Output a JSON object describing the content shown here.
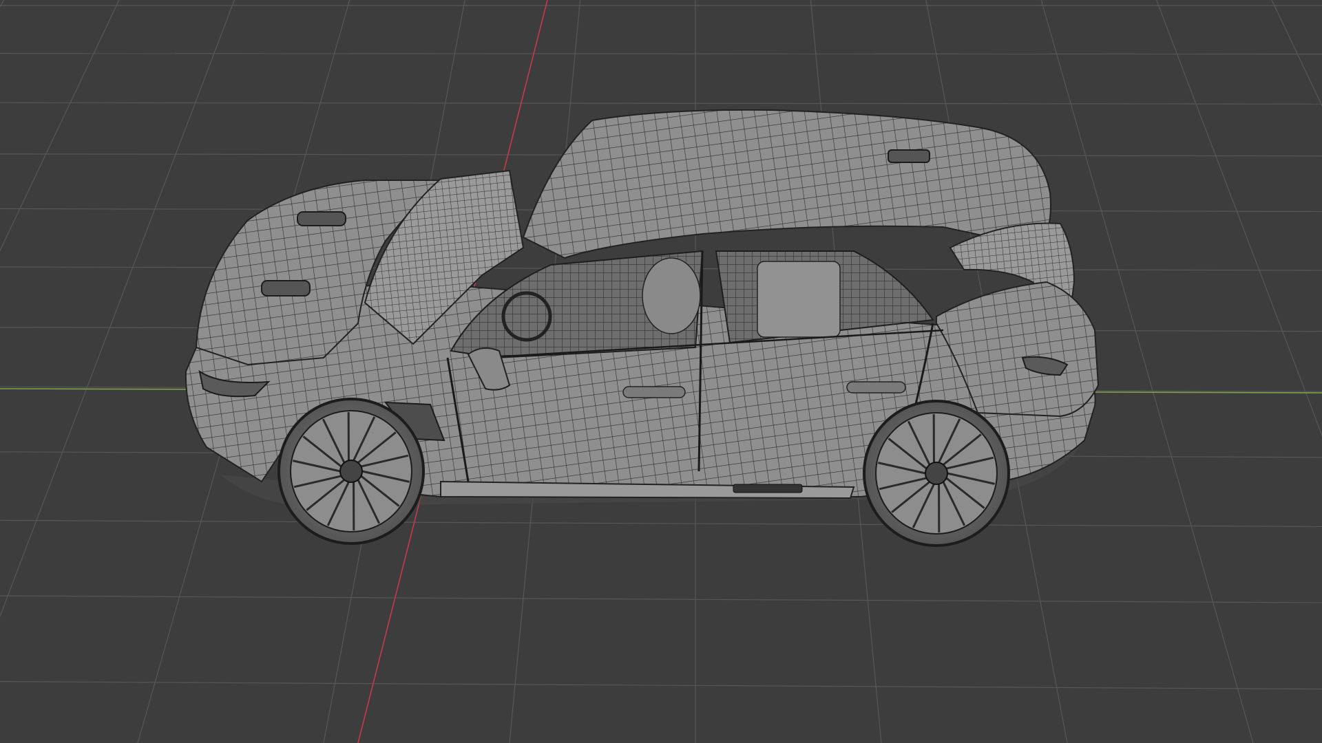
{
  "viewport": {
    "background_color": "#3d3d3d",
    "grid_line_color": "#575757",
    "x_axis_color": "#c8394a",
    "y_axis_color": "#7ea14a",
    "shading": "wireframe"
  },
  "model": {
    "subject": "hatchback car",
    "body_color": "#8e8e8e",
    "wire_color": "#2b2b2b",
    "side_badge_text": ""
  }
}
